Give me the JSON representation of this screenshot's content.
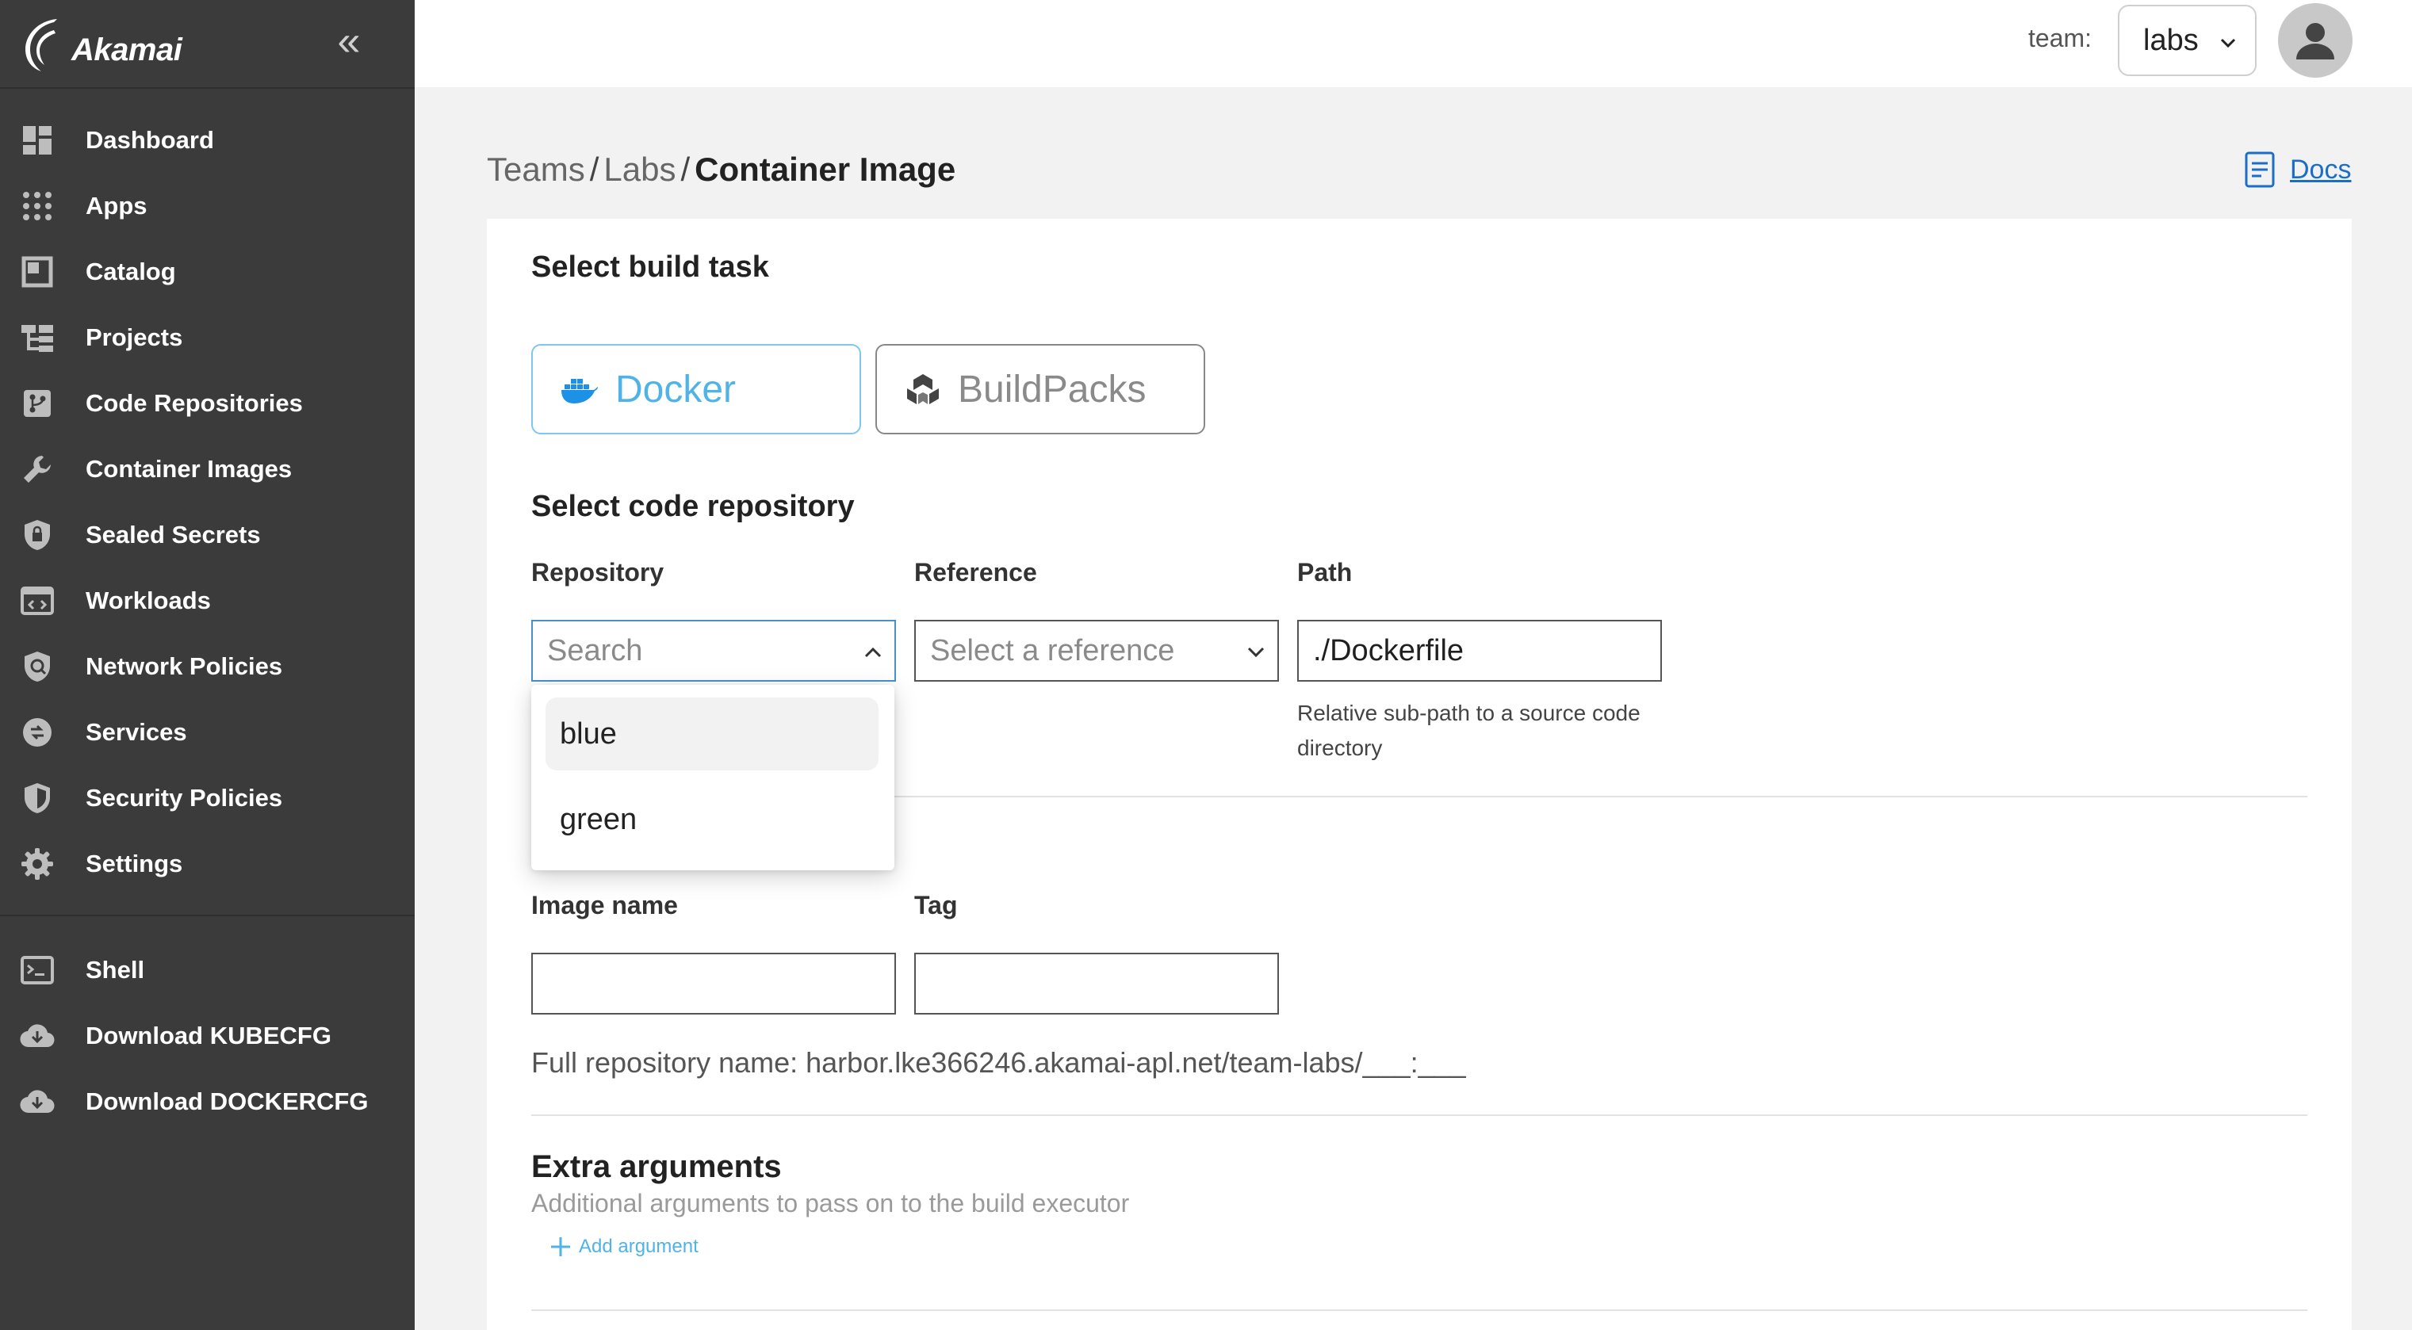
{
  "brand": {
    "name": "Akamai"
  },
  "sidebar": {
    "items": [
      {
        "label": "Dashboard",
        "icon": "dashboard-icon"
      },
      {
        "label": "Apps",
        "icon": "apps-grid-icon"
      },
      {
        "label": "Catalog",
        "icon": "catalog-icon"
      },
      {
        "label": "Projects",
        "icon": "projects-icon"
      },
      {
        "label": "Code Repositories",
        "icon": "code-repository-icon"
      },
      {
        "label": "Container Images",
        "icon": "wrench-icon"
      },
      {
        "label": "Sealed Secrets",
        "icon": "shield-lock-icon"
      },
      {
        "label": "Workloads",
        "icon": "workloads-icon"
      },
      {
        "label": "Network Policies",
        "icon": "network-policy-icon"
      },
      {
        "label": "Services",
        "icon": "services-icon"
      },
      {
        "label": "Security Policies",
        "icon": "security-shield-icon"
      },
      {
        "label": "Settings",
        "icon": "gear-icon"
      }
    ],
    "bottom_items": [
      {
        "label": "Shell",
        "icon": "terminal-icon"
      },
      {
        "label": "Download KUBECFG",
        "icon": "cloud-download-icon"
      },
      {
        "label": "Download DOCKERCFG",
        "icon": "cloud-download-icon"
      }
    ]
  },
  "header": {
    "team_label": "team:",
    "team_value": "labs"
  },
  "breadcrumb": {
    "items": [
      "Teams",
      "Labs"
    ],
    "current": "Container Image",
    "separator": "/"
  },
  "docs": {
    "label": "Docs"
  },
  "form": {
    "build_task": {
      "title": "Select build task",
      "options": [
        {
          "label": "Docker",
          "selected": true
        },
        {
          "label": "BuildPacks",
          "selected": false
        }
      ]
    },
    "code_repo": {
      "title": "Select code repository",
      "repository": {
        "label": "Repository",
        "placeholder": "Search",
        "options": [
          "blue",
          "green"
        ]
      },
      "reference": {
        "label": "Reference",
        "placeholder": "Select a reference"
      },
      "path": {
        "label": "Path",
        "value": "./Dockerfile",
        "helper": "Relative sub-path to a source code directory"
      }
    },
    "image": {
      "image_name_label": "Image name",
      "tag_label": "Tag",
      "full_repo_prefix": "Full repository name: ",
      "full_repo_value": "harbor.lke366246.akamai-apl.net/team-labs/___:___"
    },
    "extra_args": {
      "title": "Extra arguments",
      "subtitle": "Additional arguments to pass on to the build executor",
      "add_label": "Add argument"
    }
  },
  "colors": {
    "sidebar": "#3b3b3b",
    "accent": "#4fb3e8",
    "link": "#1a6ec7"
  }
}
